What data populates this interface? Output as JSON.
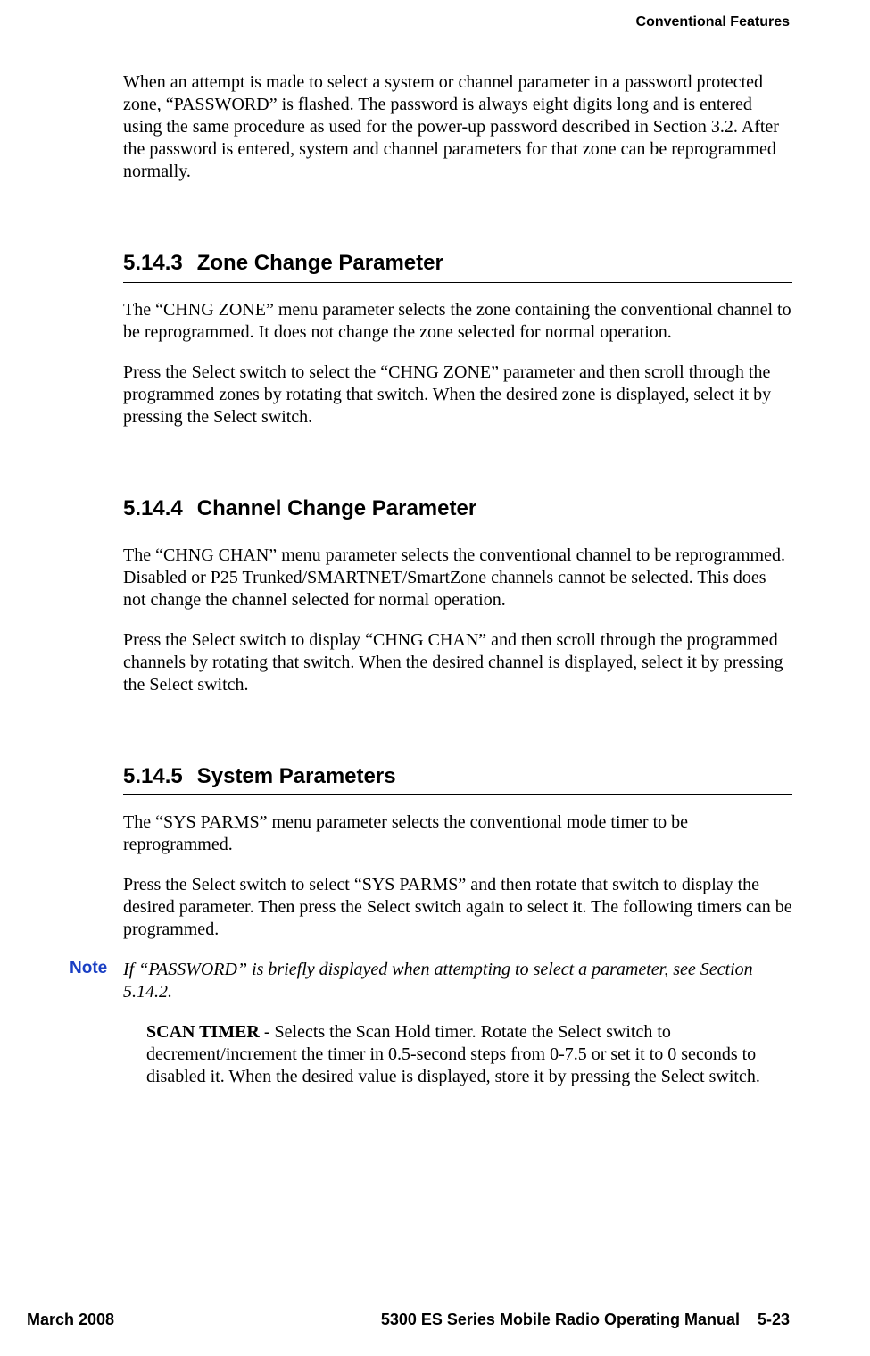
{
  "header": {
    "section": "Conventional Features"
  },
  "intro_para": "When an attempt is made to select a system or channel parameter in a password protected zone, “PASSWORD” is flashed. The password is always eight digits long and is entered using the same procedure as used for the power-up password described in Section 3.2. After the password is entered, system and channel parameters for that zone can be reprogrammed normally.",
  "sections": [
    {
      "number": "5.14.3",
      "title": "Zone Change Parameter",
      "paras": [
        "The “CHNG ZONE” menu parameter selects the zone containing the conventional channel to be reprogrammed. It does not change the zone selected for normal operation.",
        "Press the Select switch to select the “CHNG ZONE” parameter and then scroll through the programmed zones by rotating that switch. When the desired zone is displayed, select it by pressing the Select switch."
      ]
    },
    {
      "number": "5.14.4",
      "title": "Channel Change Parameter",
      "paras": [
        "The “CHNG CHAN” menu parameter selects the conventional channel to be reprogrammed. Disabled or P25 Trunked/SMARTNET/SmartZone channels cannot be selected. This does not change the channel selected for normal operation.",
        "Press the Select switch to display “CHNG CHAN” and then scroll through the programmed channels by rotating that switch. When the desired channel is displayed, select it by pressing the Select switch."
      ]
    },
    {
      "number": "5.14.5",
      "title": "System Parameters",
      "paras": [
        "The “SYS PARMS” menu parameter selects the conventional mode timer to be reprogrammed.",
        "Press the Select switch to select “SYS PARMS” and then rotate that switch to display the desired parameter. Then press the Select switch again to select it. The following timers can be programmed."
      ],
      "note": {
        "label": "Note",
        "text": "If “PASSWORD” is briefly displayed when attempting to select a parameter, see Section 5.14.2."
      },
      "sub_item": {
        "bold_lead": "SCAN TIMER",
        "rest": " - Selects the Scan Hold timer. Rotate the Select switch to decrement/increment the timer in 0.5-second steps from 0-7.5 or set it to 0 seconds to disabled it. When the desired value is displayed, store it by pressing the Select switch."
      }
    }
  ],
  "footer": {
    "left": "March 2008",
    "center": "5300 ES Series Mobile Radio Operating Manual",
    "right": "5-23"
  }
}
